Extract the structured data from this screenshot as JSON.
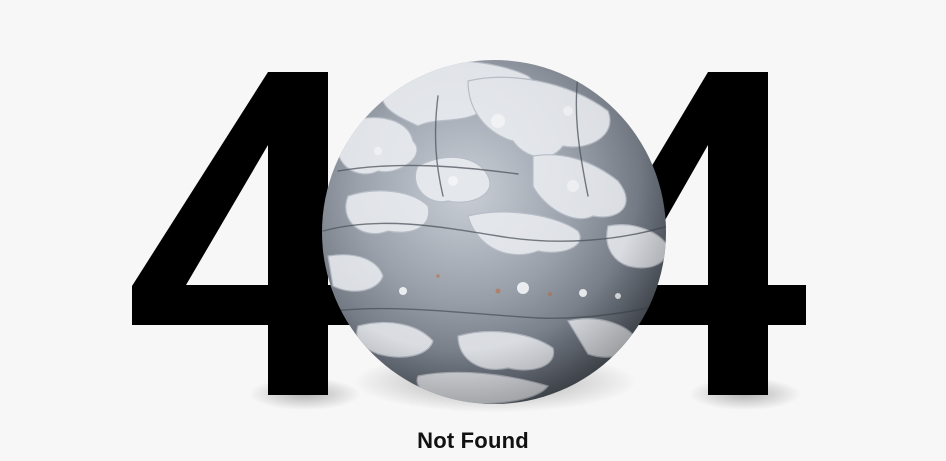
{
  "error": {
    "left_digit": "4",
    "middle_digit": "0",
    "right_digit": "4",
    "message": "Not Found"
  },
  "colors": {
    "background": "#f7f7f7",
    "digit": "#000000",
    "message_text": "#111111",
    "sphere_base": "#8f96a0",
    "sphere_flake": "#e6e9ee"
  },
  "icons": {
    "middle_digit_graphic": "weathered-globe-icon"
  }
}
